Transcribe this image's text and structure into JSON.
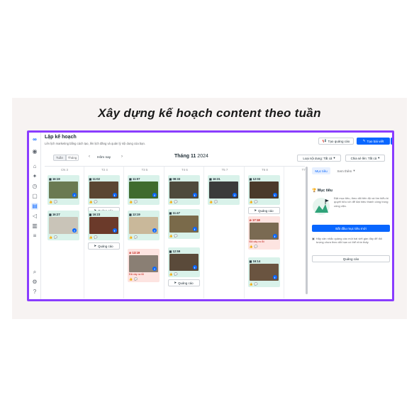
{
  "headline": "Xây dựng kế hoạch content theo tuần",
  "header": {
    "title": "Lập kế hoạch",
    "subtitle": "Lên lịch marketing bằng cách tạo, lên lịch đăng và quản lý nội dung của bạn.",
    "create_ad": "Tạo quảng cáo",
    "create_post": "Tạo bài viết"
  },
  "toolbar": {
    "week": "Tuần",
    "month": "Tháng",
    "today": "Hôm nay",
    "month_label": "Tháng 11",
    "year": "2024",
    "content_type": "Loại nội dung: Tất cả",
    "account": "Chia sẻ lên: Tất cả"
  },
  "days": [
    {
      "label": "CN 3"
    },
    {
      "label": "T2 4"
    },
    {
      "label": "T3 5"
    },
    {
      "label": "T4 6"
    },
    {
      "label": "T5 7"
    },
    {
      "label": "T6 8"
    },
    {
      "label": "T7 9"
    }
  ],
  "posts": [
    {
      "day": 0,
      "row": 0,
      "time": "16:19",
      "status": "scheduled",
      "thumb": "#6a7a52",
      "cta": ""
    },
    {
      "day": 0,
      "row": 1,
      "time": "16:27",
      "status": "scheduled",
      "thumb": "#c9c4b8",
      "cta": ""
    },
    {
      "day": 1,
      "row": 0,
      "time": "11:02",
      "status": "scheduled",
      "thumb": "#5a4632",
      "cta": "Quảng cáo"
    },
    {
      "day": 1,
      "row": 1,
      "time": "16:23",
      "status": "scheduled",
      "thumb": "#6b3a2a",
      "cta": "Quảng cáo"
    },
    {
      "day": 2,
      "row": 0,
      "time": "11:07",
      "status": "scheduled",
      "thumb": "#3f6b2e",
      "cta": ""
    },
    {
      "day": 2,
      "row": 1,
      "time": "13:19",
      "status": "scheduled",
      "thumb": "#c9b89a",
      "cta": ""
    },
    {
      "day": 2,
      "row": 2,
      "time": "13:19",
      "status": "error",
      "thumb": "#8a7f74",
      "cta": "",
      "note": "Đã xảy ra lỗi"
    },
    {
      "day": 3,
      "row": 0,
      "time": "08:33",
      "status": "scheduled",
      "thumb": "#4e4a3c",
      "cta": ""
    },
    {
      "day": 3,
      "row": 1,
      "time": "11:47",
      "status": "scheduled",
      "thumb": "#7a6a4a",
      "cta": ""
    },
    {
      "day": 3,
      "row": 2,
      "time": "12:59",
      "status": "scheduled",
      "thumb": "#5a4a3a",
      "cta": "Quảng cáo"
    },
    {
      "day": 4,
      "row": 0,
      "time": "16:31",
      "status": "scheduled",
      "thumb": "#3b3b3b",
      "cta": ""
    },
    {
      "day": 5,
      "row": 0,
      "time": "12:03",
      "status": "scheduled",
      "thumb": "#4a3a2a",
      "cta": "Quảng cáo"
    },
    {
      "day": 5,
      "row": 1,
      "time": "17:18",
      "status": "error",
      "thumb": "#7a6a52",
      "cta": "",
      "note": "Đã xảy ra lỗi"
    },
    {
      "day": 5,
      "row": 2,
      "time": "16:14",
      "status": "scheduled",
      "thumb": "#6a5440",
      "cta": ""
    }
  ],
  "panel": {
    "tab_goal": "Mục tiêu",
    "tab_more": "Xem thêm",
    "heading": "Mục tiêu",
    "text": "Đặt mục tiêu, theo dõi tiến độ và tìm hiểu bí quyết hữu ích để đạt hiệu thành công trong công việc.",
    "button": "Bắt đầu mục tiêu mới",
    "tip": "Hãy cân nhắc quảng cáo một bài viết gần đây để đối tượng chưa theo dõi bạn có thể nhìn thấy.",
    "ad_button": "Quảng cáo"
  },
  "colors": {
    "frame": "#8a3dff",
    "accent": "#0866ff",
    "scheduled_bg": "#d9f2ea",
    "error_bg": "#fde4e1"
  }
}
